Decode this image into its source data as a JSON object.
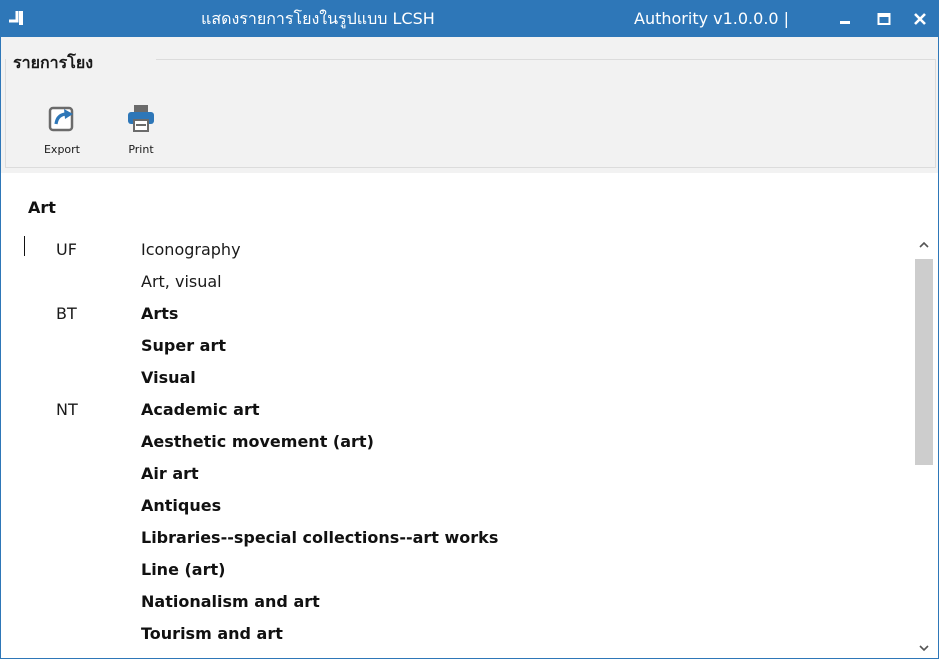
{
  "window": {
    "title": "แสดงรายการโยงในรูปแบบ LCSH",
    "version": "Authority v1.0.0.0 |",
    "accent_color": "#2e77b8",
    "controls": [
      "minimize-icon",
      "maximize-icon",
      "close-icon"
    ]
  },
  "ribbon": {
    "group_title": "รายการโยง",
    "buttons": [
      {
        "label": "Export",
        "icon": "export-icon"
      },
      {
        "label": "Print",
        "icon": "printer-icon"
      }
    ]
  },
  "content": {
    "heading": "Art",
    "rows": [
      {
        "code": "UF",
        "term": "Iconography",
        "bold": false
      },
      {
        "code": "",
        "term": "Art, visual",
        "bold": false
      },
      {
        "code": "BT",
        "term": "Arts",
        "bold": true
      },
      {
        "code": "",
        "term": "Super art",
        "bold": true
      },
      {
        "code": "",
        "term": "Visual",
        "bold": true
      },
      {
        "code": "NT",
        "term": "Academic art",
        "bold": true
      },
      {
        "code": "",
        "term": "Aesthetic movement (art)",
        "bold": true
      },
      {
        "code": "",
        "term": "Air art",
        "bold": true
      },
      {
        "code": "",
        "term": "Antiques",
        "bold": true
      },
      {
        "code": "",
        "term": "Libraries--special collections--art works",
        "bold": true
      },
      {
        "code": "",
        "term": "Line (art)",
        "bold": true
      },
      {
        "code": "",
        "term": "Nationalism and art",
        "bold": true
      },
      {
        "code": "",
        "term": "Tourism and art",
        "bold": true
      }
    ]
  }
}
